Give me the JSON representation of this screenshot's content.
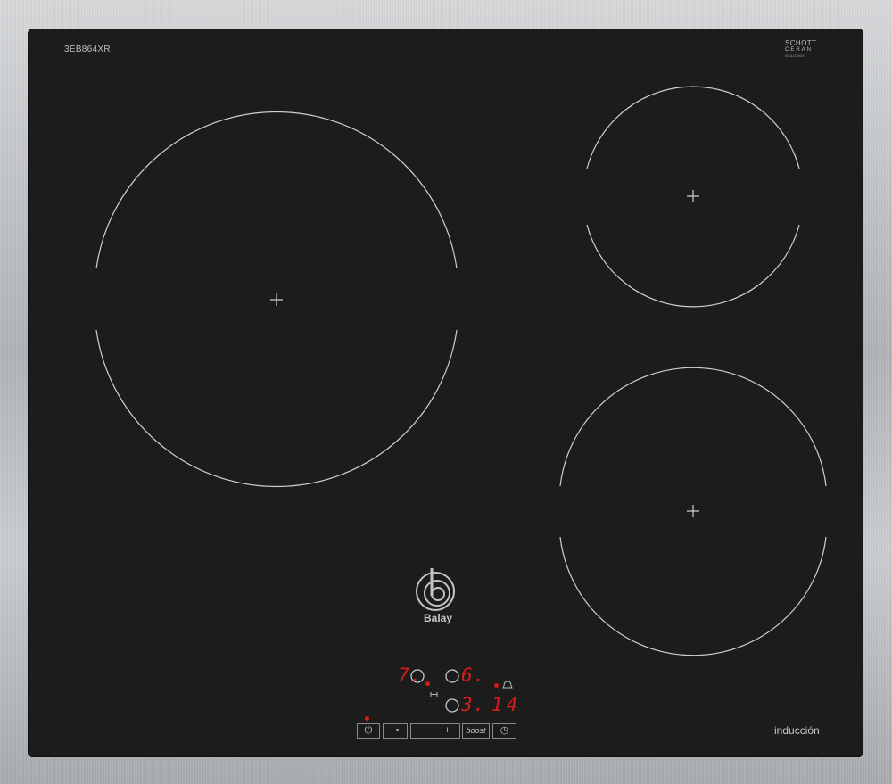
{
  "model": "3EB864XR",
  "glass_brand": {
    "line1": "SCHOTT",
    "line2": "CERAN",
    "line3": "00011D0000"
  },
  "brand": "Balay",
  "footer_label": "inducción",
  "displays": {
    "zone_left": "7.",
    "zone_rear_right": "6.",
    "zone_front_right": "3.",
    "timer": "14"
  },
  "controls": {
    "power_symbol": "⏻",
    "lock_symbol": "⊸",
    "minus": "−",
    "plus": "+",
    "boost": "boost",
    "timer_symbol": "◷"
  },
  "colors": {
    "glass": "#1d1c1c",
    "frame": "#b9bcbf",
    "zone_lines": "#cfcfcf",
    "indicator": "#d61b1b"
  }
}
